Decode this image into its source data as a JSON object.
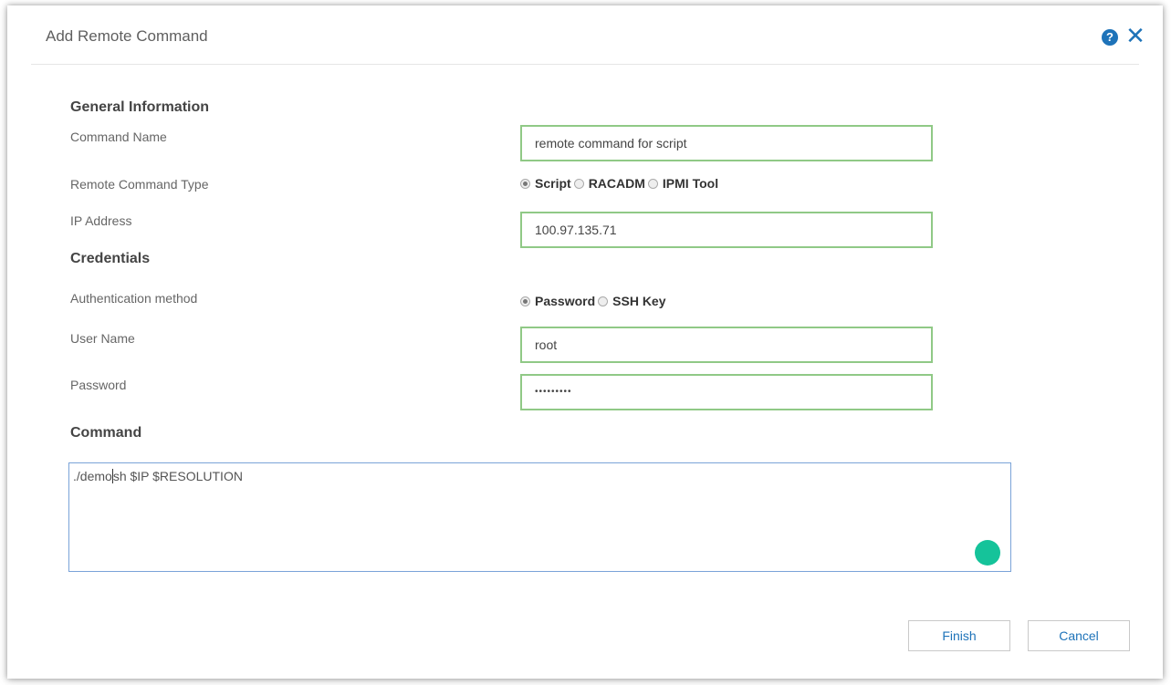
{
  "dialog": {
    "title": "Add Remote Command",
    "help_icon_glyph": "?",
    "close_icon_glyph": "✕",
    "accent_color": "#1e73b9"
  },
  "general": {
    "heading": "General Information",
    "command_name_label": "Command Name",
    "command_name_value": "remote command for script",
    "command_type_label": "Remote Command Type",
    "command_type_options": [
      "Script",
      "RACADM",
      "IPMI Tool"
    ],
    "command_type_selected": "Script",
    "ip_label": "IP Address",
    "ip_value": "100.97.135.71"
  },
  "credentials": {
    "heading": "Credentials",
    "auth_label": "Authentication method",
    "auth_options": [
      "Password",
      "SSH Key"
    ],
    "auth_selected": "Password",
    "user_label": "User Name",
    "user_value": "root",
    "password_label": "Password",
    "password_value": "•••••••••"
  },
  "command": {
    "heading": "Command",
    "text_before_cursor": "./demo",
    "text_after_cursor": "sh $IP $RESOLUTION"
  },
  "footer": {
    "finish_label": "Finish",
    "cancel_label": "Cancel"
  }
}
